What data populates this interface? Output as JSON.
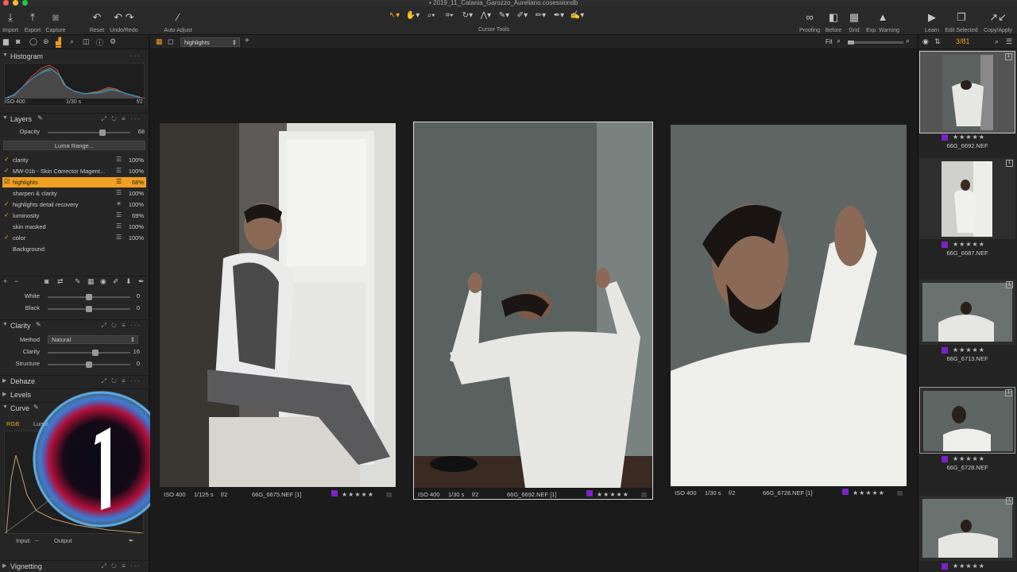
{
  "window": {
    "title": "2019_11_Catania_Garozzo_Aureliano.cosessiondb"
  },
  "toolbar": {
    "left": [
      {
        "label": "Import",
        "icon": "import-icon"
      },
      {
        "label": "Export",
        "icon": "export-icon"
      },
      {
        "label": "Capture",
        "icon": "camera-icon"
      },
      {
        "label": "Reset",
        "icon": "reset-icon"
      },
      {
        "label": "Undo/Redo",
        "icon": "undo-redo-icon"
      },
      {
        "label": "Auto Adjust",
        "icon": "magic-wand-icon"
      }
    ],
    "cursor_tools_label": "Cursor Tools",
    "right": [
      {
        "label": "Proofing",
        "icon": "glasses-icon"
      },
      {
        "label": "Before",
        "icon": "before-after-icon"
      },
      {
        "label": "Grid",
        "icon": "grid-icon"
      },
      {
        "label": "Exp. Warning",
        "icon": "warning-icon"
      },
      {
        "label": "Learn",
        "icon": "play-icon"
      },
      {
        "label": "Edit Selected",
        "icon": "stack-icon"
      },
      {
        "label": "Copy/Apply",
        "icon": "copy-apply-icon"
      }
    ]
  },
  "histogram": {
    "title": "Histogram",
    "iso": "ISO 400",
    "shutter": "1/30 s",
    "aperture": "f/2"
  },
  "layers": {
    "title": "Layers",
    "opacity_label": "Opacity",
    "opacity_value": "68",
    "opacity_fraction": 0.68,
    "luma_range_label": "Luma Range...",
    "items": [
      {
        "name": "clarity",
        "checked": true,
        "pct": "100%",
        "selected": false,
        "mix": "sliders-icon"
      },
      {
        "name": "MW-01b - Skin Corrector Magent...",
        "checked": true,
        "pct": "100%",
        "selected": false,
        "mix": "sliders-icon"
      },
      {
        "name": "highlights",
        "checked": true,
        "pct": "68%",
        "selected": true,
        "mix": "sliders-icon"
      },
      {
        "name": "sharpen & clarity",
        "checked": false,
        "pct": "100%",
        "selected": false,
        "mix": "sliders-icon"
      },
      {
        "name": "highlights detail recovery",
        "checked": false,
        "pct": "100%",
        "selected": false,
        "mix": "sun-icon"
      },
      {
        "name": "luminosity",
        "checked": true,
        "pct": "69%",
        "selected": false,
        "mix": "sliders-icon"
      },
      {
        "name": "skin masked",
        "checked": false,
        "pct": "100%",
        "selected": false,
        "mix": "sliders-icon"
      },
      {
        "name": "color",
        "checked": true,
        "pct": "100%",
        "selected": false,
        "mix": "sliders-icon"
      },
      {
        "name": "Background",
        "checked": false,
        "pct": "",
        "selected": false,
        "mix": ""
      }
    ]
  },
  "levels_sliders": [
    {
      "label": "White",
      "value": "0",
      "fraction": 0.5
    },
    {
      "label": "Black",
      "value": "0",
      "fraction": 0.5
    }
  ],
  "clarity": {
    "title": "Clarity",
    "method_label": "Method",
    "method_value": "Natural",
    "sliders": [
      {
        "label": "Clarity",
        "value": "16",
        "fraction": 0.58
      },
      {
        "label": "Structure",
        "value": "0",
        "fraction": 0.5
      }
    ]
  },
  "sections": {
    "dehaze": "Dehaze",
    "levels": "Levels",
    "curve": "Curve",
    "vignetting": "Vignetting"
  },
  "curve": {
    "tab_rgb": "RGB",
    "tab_luma": "Luma",
    "input_label": "Input:",
    "input_value": "--",
    "output_label": "Output"
  },
  "viewer": {
    "variant": "highlights",
    "zoom": "Fit",
    "photos": [
      {
        "iso": "ISO 400",
        "shutter": "1/125 s",
        "aperture": "f/2",
        "name": "66G_6675.NEF [1]",
        "stars": "★★★★★"
      },
      {
        "iso": "ISO 400",
        "shutter": "1/30 s",
        "aperture": "f/2",
        "name": "66G_6692.NEF [1]",
        "stars": "★★★★★"
      },
      {
        "iso": "ISO 400",
        "shutter": "1/30 s",
        "aperture": "f/2",
        "name": "66G_6728.NEF [1]",
        "stars": "★★★★★"
      }
    ]
  },
  "browser": {
    "count": "3/81",
    "thumbs": [
      {
        "name": "66G_6692.NEF",
        "num": "1",
        "stars": "★★★★★",
        "selected": true
      },
      {
        "name": "66G_6687.NEF",
        "num": "1",
        "stars": "★★★★★",
        "selected": false
      },
      {
        "name": "66G_6713.NEF",
        "num": "1",
        "stars": "★★★★★",
        "selected": false
      },
      {
        "name": "66G_6728.NEF",
        "num": "1",
        "stars": "★★★★★",
        "selected": false
      },
      {
        "name": "",
        "num": "1",
        "stars": "★★★★★",
        "selected": false
      }
    ]
  },
  "colors": {
    "accent": "#f0a020",
    "color_tag": "#7a22c8"
  }
}
